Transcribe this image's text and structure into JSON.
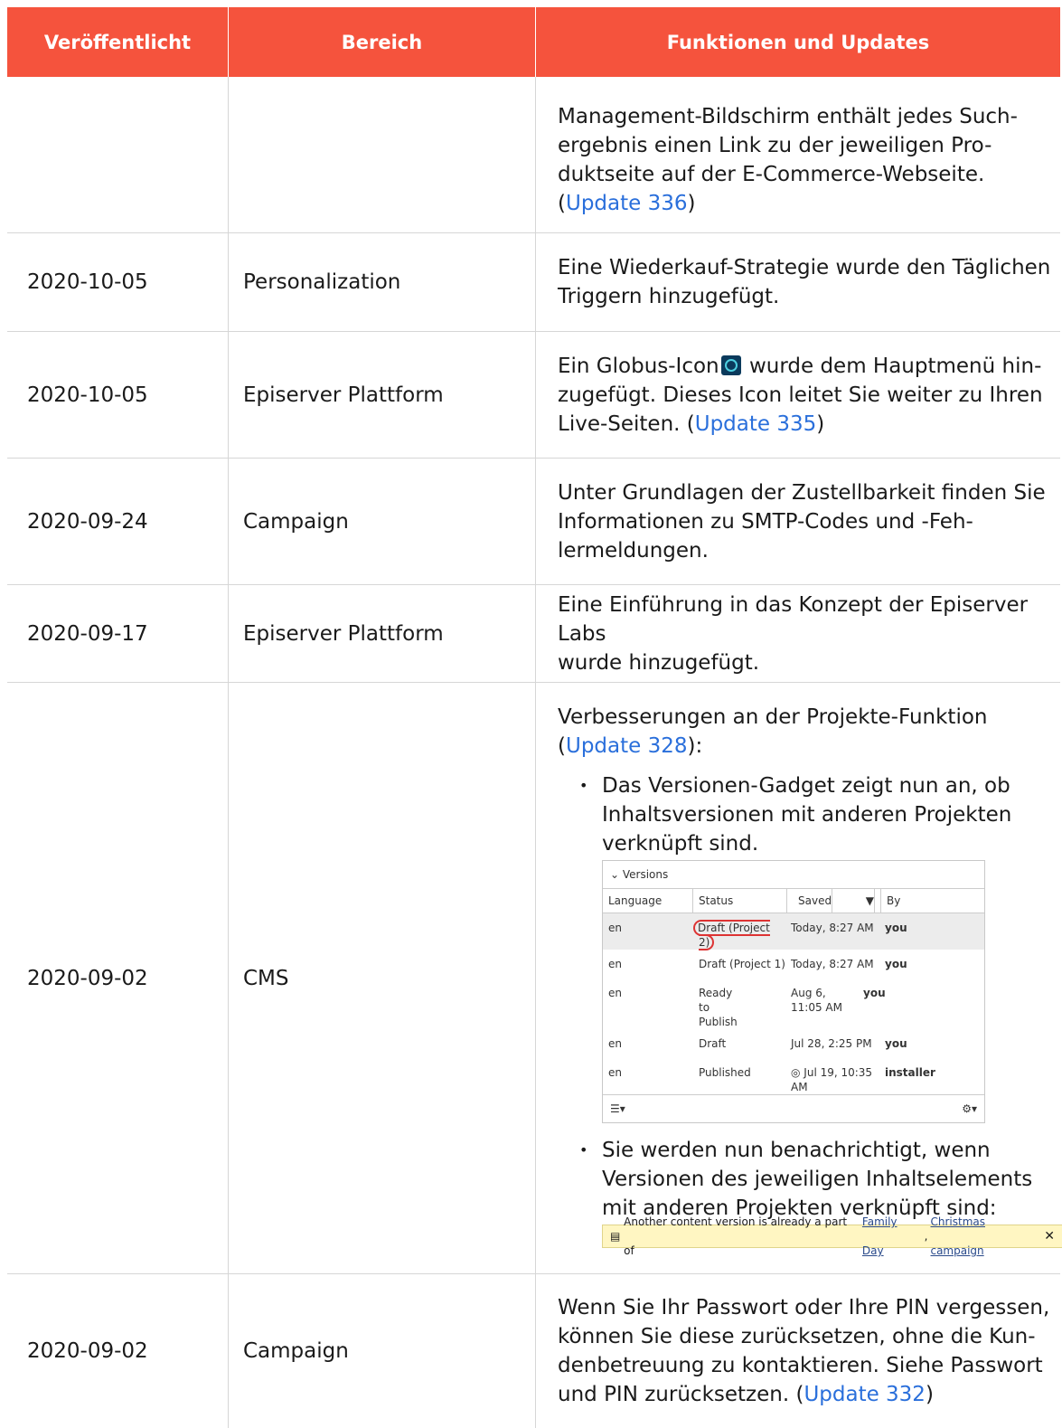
{
  "header": {
    "col1": "Veröffentlicht",
    "col2": "Bereich",
    "col3": "Funktionen und Updates"
  },
  "rows": [
    {
      "date": "",
      "area": "",
      "text1": "Management-Bildschirm enthält jedes Such-",
      "text2": "ergebnis einen Link zu der jeweiligen Pro-",
      "text3": "duktseite auf der E-Commerce-Webseite.",
      "link": "Update 336"
    },
    {
      "date": "2020-10-05",
      "area": "Personalization",
      "text1": "Eine Wiederkauf-Strategie wurde den Täglichen",
      "text2": "Triggern hinzugefügt."
    },
    {
      "date": "2020-10-05",
      "area": "Episerver Plattform",
      "text1": "Ein Globus-Icon",
      "text1b": " wurde dem Hauptmenü hin-",
      "text2": "zugefügt. Dieses Icon leitet Sie weiter zu Ihren",
      "text3": "Live-Seiten. (",
      "link": "Update 335"
    },
    {
      "date": "2020-09-24",
      "area": "Campaign",
      "text1": "Unter Grundlagen der Zustellbarkeit finden Sie",
      "text2": "Informationen zu SMTP-Codes und -Feh-",
      "text3": "lermeldungen."
    },
    {
      "date": "2020-09-17",
      "area": "Episerver Plattform",
      "text1": "Eine Einführung in das Konzept der Episerver Labs",
      "text2": "wurde hinzugefügt."
    },
    {
      "date": "2020-09-02",
      "area": "CMS",
      "text1": "Verbesserungen an der Projekte-Funktion",
      "link": "Update 328",
      "bullet1": "Das Versionen-Gadget zeigt nun an, ob Inhaltsversionen mit anderen Projekten verknüpft sind.",
      "bullet2": "Sie werden nun benachrichtigt, wenn Versionen des jeweiligen Inhaltselements mit anderen Projekten verknüpft sind:"
    },
    {
      "date": "2020-09-02",
      "area": "Campaign",
      "text1": "Wenn Sie Ihr Passwort oder Ihre PIN vergessen,",
      "text2": "können Sie diese zurücksetzen, ohne die Kun-",
      "text3": "denbetreuung zu kontaktieren. Siehe Passwort",
      "text4": "und PIN zurücksetzen. (",
      "link": "Update 332"
    }
  ],
  "gadget": {
    "title": "Versions",
    "cols": [
      "Language",
      "Status",
      "Saved",
      "By"
    ],
    "rows": [
      {
        "lang": "en",
        "status": "Draft (Project 2)",
        "saved": "Today, 8:27 AM",
        "by": "you"
      },
      {
        "lang": "en",
        "status": "Draft (Project 1)",
        "saved": "Today, 8:27 AM",
        "by": "you"
      },
      {
        "lang": "en",
        "status": "Ready to Publish",
        "saved": "Aug 6, 11:05 AM",
        "by": "you"
      },
      {
        "lang": "en",
        "status": "Draft",
        "saved": "Jul 28, 2:25 PM",
        "by": "you"
      },
      {
        "lang": "en",
        "status": "Published",
        "saved": "Jul 19, 10:35 AM",
        "by": "installer"
      }
    ]
  },
  "notice": {
    "text": "Another content version is already a part of",
    "link1": "Family Day",
    "sep": ",",
    "link2": "Christmas campaign",
    "close": "✕"
  }
}
